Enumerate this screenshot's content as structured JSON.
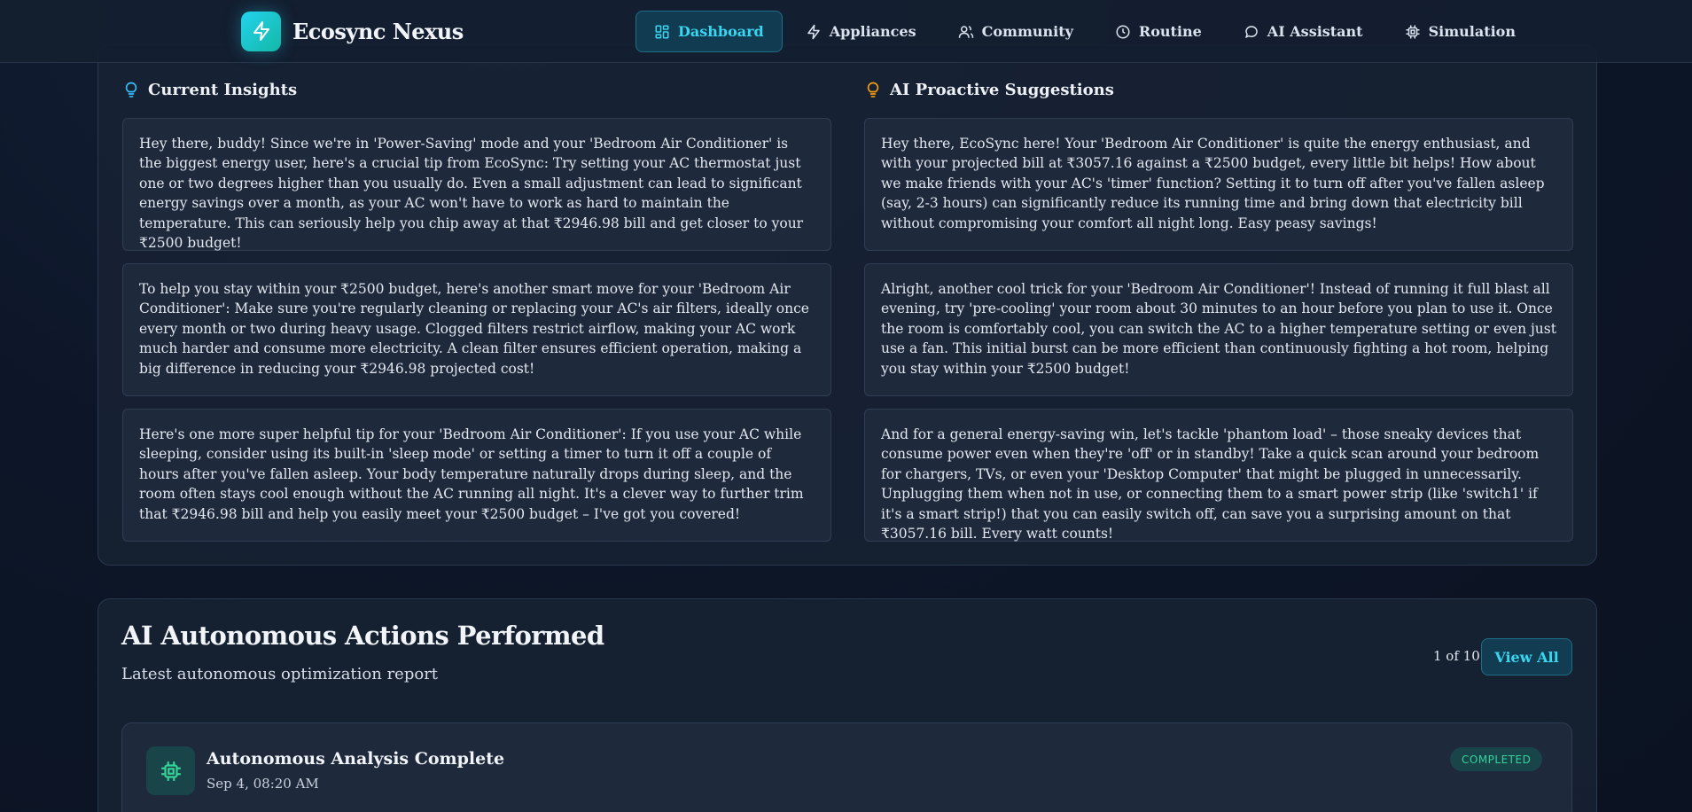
{
  "brand": {
    "name": "Ecosync Nexus"
  },
  "nav": {
    "items": [
      {
        "label": "Dashboard",
        "icon": "grid-icon",
        "active": true
      },
      {
        "label": "Appliances",
        "icon": "lightning-icon"
      },
      {
        "label": "Community",
        "icon": "users-icon"
      },
      {
        "label": "Routine",
        "icon": "clock-icon"
      },
      {
        "label": "AI Assistant",
        "icon": "chat-bubble-icon"
      },
      {
        "label": "Simulation",
        "icon": "chip-icon"
      }
    ]
  },
  "insights": {
    "title": "Current Insights",
    "cards": [
      "Hey there, buddy! Since we're in 'Power-Saving' mode and your 'Bedroom Air Conditioner' is the biggest energy user, here's a crucial tip from EcoSync: Try setting your AC thermostat just one or two degrees higher than you usually do. Even a small adjustment can lead to significant energy savings over a month, as your AC won't have to work as hard to maintain the temperature. This can seriously help you chip away at that ₹2946.98 bill and get closer to your ₹2500 budget!",
      "To help you stay within your ₹2500 budget, here's another smart move for your 'Bedroom Air Conditioner': Make sure you're regularly cleaning or replacing your AC's air filters, ideally once every month or two during heavy usage. Clogged filters restrict airflow, making your AC work much harder and consume more electricity. A clean filter ensures efficient operation, making a big difference in reducing your ₹2946.98 projected cost!",
      "Here's one more super helpful tip for your 'Bedroom Air Conditioner': If you use your AC while sleeping, consider using its built-in 'sleep mode' or setting a timer to turn it off a couple of hours after you've fallen asleep. Your body temperature naturally drops during sleep, and the room often stays cool enough without the AC running all night. It's a clever way to further trim that ₹2946.98 bill and help you easily meet your ₹2500 budget – I've got you covered!"
    ]
  },
  "suggestions": {
    "title": "AI Proactive Suggestions",
    "cards": [
      "Hey there, EcoSync here! Your 'Bedroom Air Conditioner' is quite the energy enthusiast, and with your projected bill at ₹3057.16 against a ₹2500 budget, every little bit helps! How about we make friends with your AC's 'timer' function? Setting it to turn off after you've fallen asleep (say, 2-3 hours) can significantly reduce its running time and bring down that electricity bill without compromising your comfort all night long. Easy peasy savings!",
      "Alright, another cool trick for your 'Bedroom Air Conditioner'! Instead of running it full blast all evening, try 'pre-cooling' your room about 30 minutes to an hour before you plan to use it. Once the room is comfortably cool, you can switch the AC to a higher temperature setting or even just use a fan. This initial burst can be more efficient than continuously fighting a hot room, helping you stay within your ₹2500 budget!",
      "And for a general energy-saving win, let's tackle 'phantom load' – those sneaky devices that consume power even when they're 'off' or in standby! Take a quick scan around your bedroom for chargers, TVs, or even your 'Desktop Computer' that might be plugged in unnecessarily. Unplugging them when not in use, or connecting them to a smart power strip (like 'switch1' if it's a smart strip!) that you can easily switch off, can save you a surprising amount on that ₹3057.16 bill. Every watt counts!"
    ]
  },
  "actions": {
    "title": "AI Autonomous Actions Performed",
    "subtitle": "Latest autonomous optimization report",
    "page_count": "1 of 10",
    "view_all_label": "View All",
    "items": [
      {
        "title": "Autonomous Analysis Complete",
        "date": "Sep 4, 08:20 AM",
        "status": "COMPLETED",
        "icon": "chip-icon"
      }
    ]
  },
  "colors": {
    "accent": "#38d6f0",
    "bulb_cyan": "#38bdf8",
    "bulb_amber": "#f59e0b",
    "success": "#34d399"
  }
}
